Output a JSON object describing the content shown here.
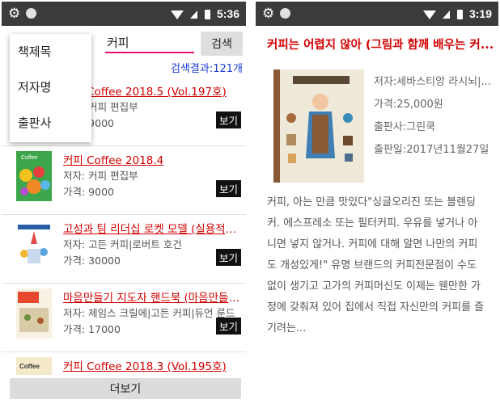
{
  "left": {
    "status": {
      "time": "5:36"
    },
    "search": {
      "value": "커피",
      "button_label": "검색"
    },
    "result_count": "검색결과:121개",
    "dropdown": {
      "options": [
        "책제목",
        "저자명",
        "출판사"
      ]
    },
    "items": [
      {
        "title": "커피 Coffee 2018.5 (Vol.197호)",
        "author": "저자: 커피 편집부",
        "price": "가격: 9000",
        "view": "보기"
      },
      {
        "title": "커피 Coffee 2018.4",
        "author": "저자: 커피 편집부",
        "price": "가격: 9000",
        "view": "보기"
      },
      {
        "title": "고성과 팀 리더십 로켓 모델 (실용적인...",
        "author": "저자: 고든 커피|로버트 호건",
        "price": "가격: 30000",
        "view": "보기"
      },
      {
        "title": "마음만들기 지도자 핸드북 (마음만들기...",
        "author": "저자: 제임스 크릴에|고든 커피|듀언 룬드",
        "price": "가격: 17000",
        "view": "보기"
      },
      {
        "title": "커피 Coffee 2018.3 (Vol.195호)"
      }
    ],
    "more_button": "더보기"
  },
  "right": {
    "status": {
      "time": "3:19"
    },
    "title": "커피는 어렵지 않아 (그림과 함께 배우는 커...",
    "author": "저자:세바스티앙 라시뇌|...",
    "price": "가격:25,000원",
    "publisher": "출판사:그린쿡",
    "date": "출판일:2017년11월27일",
    "description_lines": [
      "커피, 아는 만큼 맛있다\"싱글오리진 또는 블렌딩",
      "커. 에스프레소 또는 필터커피. 우유를 넣거나 아",
      "니면 넣지 않거나. 커피에 대해 알면 나만의 커피",
      "도 개성있게!\" 유명 브랜드의 커피전문점이 수도",
      "없이 생기고 고가의 커피머신도 이제는 웬만한 가",
      "정에 갖춰져 있어 집에서 직접 자신만의 커피를 즐",
      "기려는..."
    ]
  },
  "colors": {
    "status_bar": "#3b3b3b",
    "link_red": "#d40000",
    "accent_pink": "#e0146b",
    "count_blue": "#1a3cd8"
  },
  "icons": [
    "gear-icon",
    "status-dot-icon",
    "wifi-icon",
    "signal-icon",
    "battery-icon",
    "spinner-arrow-icon"
  ]
}
